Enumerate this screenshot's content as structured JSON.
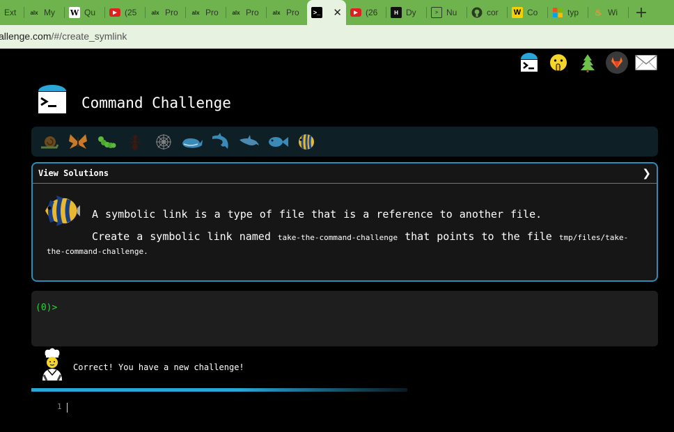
{
  "browser": {
    "tabs": [
      {
        "label": "Ext",
        "icon": "blank-tab-icon"
      },
      {
        "label": "My",
        "icon": "alx-icon"
      },
      {
        "label": "Qu",
        "icon": "wikipedia-icon"
      },
      {
        "label": "(25",
        "icon": "youtube-icon"
      },
      {
        "label": "Pro",
        "icon": "alx-icon"
      },
      {
        "label": "Pro",
        "icon": "alx-icon"
      },
      {
        "label": "Pro",
        "icon": "alx-icon"
      },
      {
        "label": "Pro",
        "icon": "alx-icon"
      },
      {
        "label": "",
        "icon": "terminal-icon",
        "active": true
      },
      {
        "label": "(26",
        "icon": "youtube-icon"
      },
      {
        "label": "Dy",
        "icon": "hackerrank-icon"
      },
      {
        "label": "Nu",
        "icon": "page-icon"
      },
      {
        "label": "cor",
        "icon": "github-icon"
      },
      {
        "label": "Co",
        "icon": "w-icon"
      },
      {
        "label": "typ",
        "icon": "microsoft-icon"
      },
      {
        "label": "Wi",
        "icon": "flame-icon"
      }
    ],
    "close_symbol": "✕",
    "new_tab_symbol": "+",
    "url_prefix": "allenge.com",
    "url_path": "/#/create_symlink"
  },
  "header": {
    "title": "Command Challenge",
    "icons": [
      "terminal-icon",
      "shush-face-icon",
      "tree-icon",
      "gitlab-icon",
      "mail-icon"
    ]
  },
  "levels": [
    "snail-icon",
    "butterfly-icon",
    "caterpillar-icon",
    "ant-icon",
    "spider-web-icon",
    "whale-icon",
    "dolphin-icon",
    "dolphin-icon",
    "fish-icon",
    "tropical-fish-icon"
  ],
  "challenge": {
    "header_label": "View Solutions",
    "chevron": "❯",
    "line1": "A symbolic link is a type of file that is a reference to another file.",
    "line2_prefix": "Create a symbolic link named ",
    "line2_code1": "take-the-command-challenge",
    "line2_mid": " that points to the file ",
    "line2_code2": "tmp/files/take-the-command-challenge",
    "line2_suffix": "."
  },
  "terminal": {
    "prompt": "(0)>"
  },
  "status": {
    "message": "Correct! You have a new challenge!"
  },
  "progress": {
    "fraction": 0.55
  },
  "editor": {
    "line_number": "1"
  },
  "colors": {
    "accent": "#2a8fb8",
    "prompt": "#2fd03a",
    "tabbar": "#6fb34f"
  }
}
